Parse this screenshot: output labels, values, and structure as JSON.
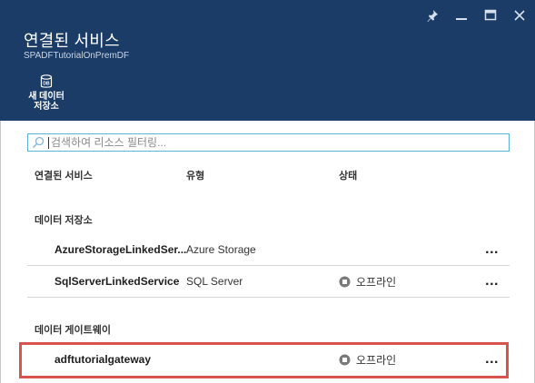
{
  "header": {
    "title": "연결된 서비스",
    "subtitle": "SPADFTutorialOnPremDF",
    "window_controls": {
      "pin_icon": "pin-icon",
      "minimize_icon": "minimize-icon",
      "maximize_icon": "maximize-icon",
      "close_icon": "close-icon"
    },
    "command": {
      "label": "새 데이터\n저장소",
      "icon": "database-icon",
      "icon_text": "DB"
    },
    "background_color": "#1b3c66"
  },
  "search": {
    "placeholder": "검색하여 리소스 필터링...",
    "value": ""
  },
  "columns": {
    "name": "연결된 서비스",
    "type": "유형",
    "status": "상태"
  },
  "sections": [
    {
      "title": "데이터 저장소",
      "rows": [
        {
          "name": "AzureStorageLinkedSer...",
          "type": "Azure Storage",
          "status": "",
          "more": "..."
        },
        {
          "name": "SqlServerLinkedService",
          "type": "SQL Server",
          "status": "오프라인",
          "more": "..."
        }
      ]
    },
    {
      "title": "데이터 게이트웨이",
      "rows": [
        {
          "name": "adftutorialgateway",
          "type": "",
          "status": "오프라인",
          "more": "..."
        }
      ]
    }
  ],
  "highlight_color": "#d9534f",
  "accent_color": "#59b4d9"
}
